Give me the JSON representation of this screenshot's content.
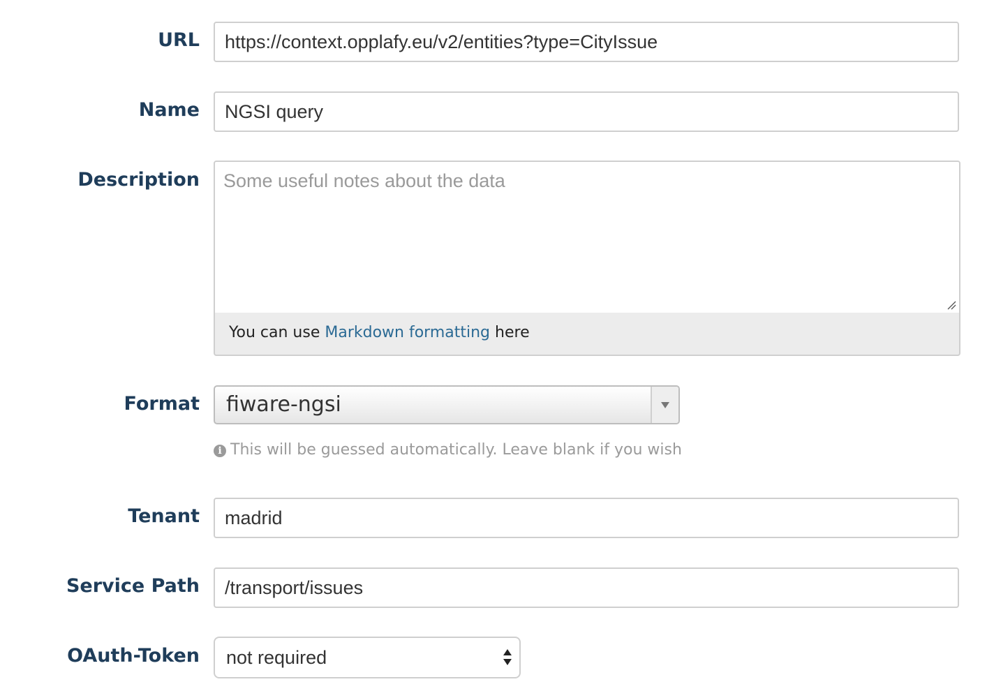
{
  "form": {
    "url": {
      "label": "URL",
      "value": "https://context.opplafy.eu/v2/entities?type=CityIssue"
    },
    "name": {
      "label": "Name",
      "value": "NGSI query"
    },
    "description": {
      "label": "Description",
      "placeholder": "Some useful notes about the data",
      "value": "",
      "hint_prefix": "You can use ",
      "hint_link": "Markdown formatting",
      "hint_suffix": " here"
    },
    "format": {
      "label": "Format",
      "selected": "fiware-ngsi",
      "help": "This will be guessed automatically. Leave blank if you wish",
      "help_icon": "info-icon"
    },
    "tenant": {
      "label": "Tenant",
      "value": "madrid"
    },
    "service_path": {
      "label": "Service Path",
      "value": "/transport/issues"
    },
    "oauth_token": {
      "label": "OAuth-Token",
      "selected": "not required"
    }
  },
  "colors": {
    "label": "#1f3d5a",
    "link": "#2b6a94",
    "help_text": "#9a9a9a",
    "border": "#cfcfcf"
  }
}
